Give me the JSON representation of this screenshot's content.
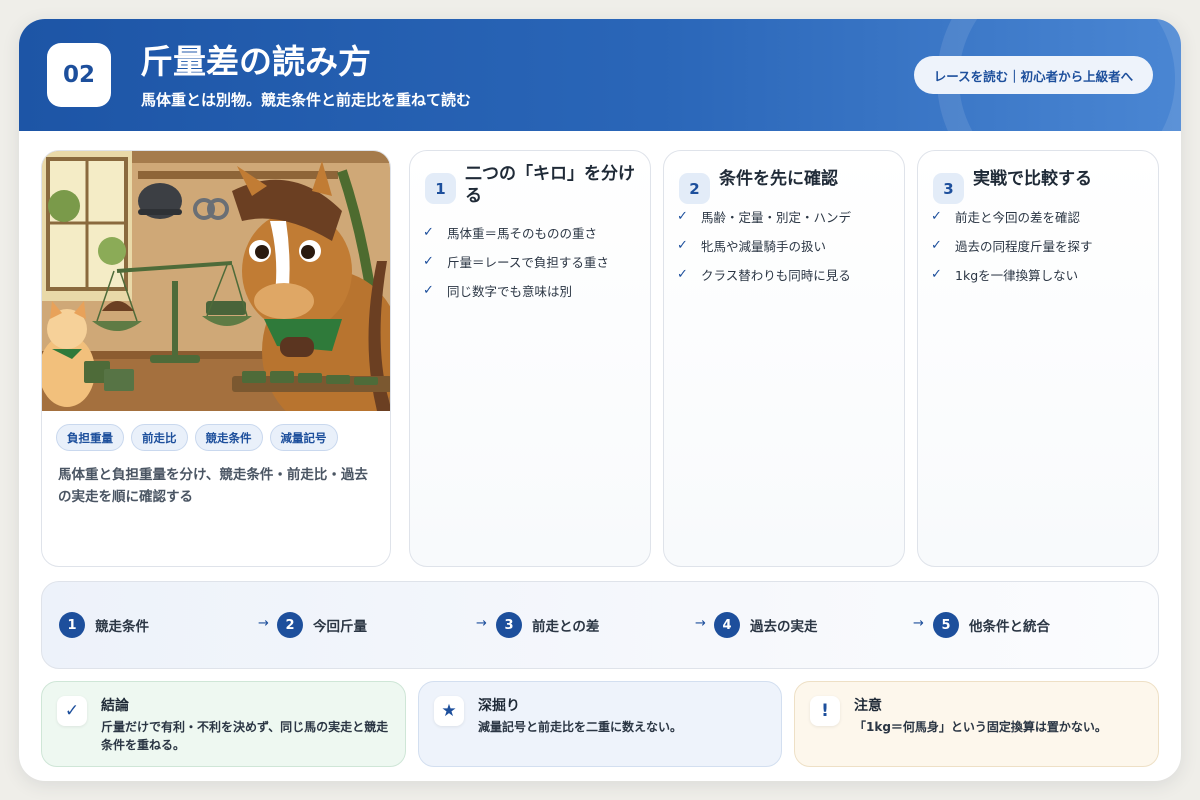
{
  "header": {
    "number": "02",
    "title": "斤量差の読み方",
    "subtitle": "馬体重とは別物。競走条件と前走比を重ねて読む",
    "link_label": "レースを読む｜初心者から上級者へ"
  },
  "image_panel": {
    "tags": [
      "負担重量",
      "前走比",
      "競走条件",
      "減量記号"
    ],
    "description": "馬体重と負担重量を分け、競走条件・前走比・過去の実走を順に確認する"
  },
  "steps": [
    {
      "number": "1",
      "title": "二つの「キロ」を分ける",
      "items": [
        "馬体重＝馬そのものの重さ",
        "斤量＝レースで負担する重さ",
        "同じ数字でも意味は別"
      ]
    },
    {
      "number": "2",
      "title": "条件を先に確認",
      "items": [
        "馬齢・定量・別定・ハンデ",
        "牝馬や減量騎手の扱い",
        "クラス替わりも同時に見る"
      ]
    },
    {
      "number": "3",
      "title": "実戦で比較する",
      "items": [
        "前走と今回の差を確認",
        "過去の同程度斤量を探す",
        "1kgを一律換算しない"
      ]
    }
  ],
  "flow": {
    "arrow": "→",
    "steps": [
      {
        "number": "1",
        "label": "競走条件"
      },
      {
        "number": "2",
        "label": "今回斤量"
      },
      {
        "number": "3",
        "label": "前走との差"
      },
      {
        "number": "4",
        "label": "過去の実走"
      },
      {
        "number": "5",
        "label": "他条件と統合"
      }
    ]
  },
  "notes": [
    {
      "icon": "check-icon",
      "symbol": "✓",
      "title": "結論",
      "text": "斤量だけで有利・不利を決めず、同じ馬の実走と競走条件を重ねる。",
      "color": "#eef8f1"
    },
    {
      "icon": "star-icon",
      "symbol": "★",
      "title": "深掘り",
      "text": "減量記号と前走比を二重に数えない。",
      "color": "#eef3fb"
    },
    {
      "icon": "exclamation-icon",
      "symbol": "!",
      "title": "注意",
      "text": "「1kg＝何馬身」という固定換算は置かない。",
      "color": "#fdf7ec"
    }
  ],
  "colors": {
    "primary": "#1d4f9c",
    "header_gradient_start": "#1d55a6",
    "header_gradient_end": "#4a86d3"
  }
}
